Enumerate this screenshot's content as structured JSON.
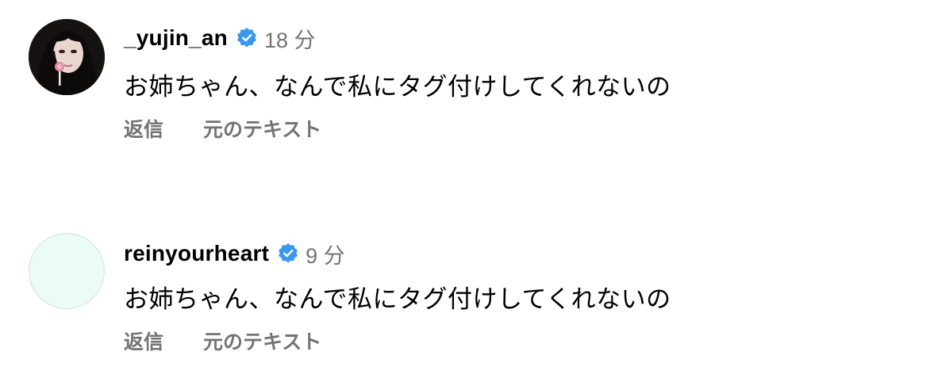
{
  "comments": [
    {
      "username": "_yujin_an",
      "time": "18 分",
      "text": "お姉ちゃん、なんで私にタグ付けしてくれないの",
      "reply_label": "返信",
      "original_text_label": "元のテキスト"
    },
    {
      "username": "reinyourheart",
      "time": "9 分",
      "text": "お姉ちゃん、なんで私にタグ付けしてくれないの",
      "reply_label": "返信",
      "original_text_label": "元のテキスト"
    }
  ],
  "icons": {
    "verified": "verified-badge-icon"
  },
  "colors": {
    "verified_badge": "#3897f0",
    "secondary_text": "#737373",
    "primary_text": "#000000",
    "avatar_blank_fill": "#ebfcf6"
  }
}
